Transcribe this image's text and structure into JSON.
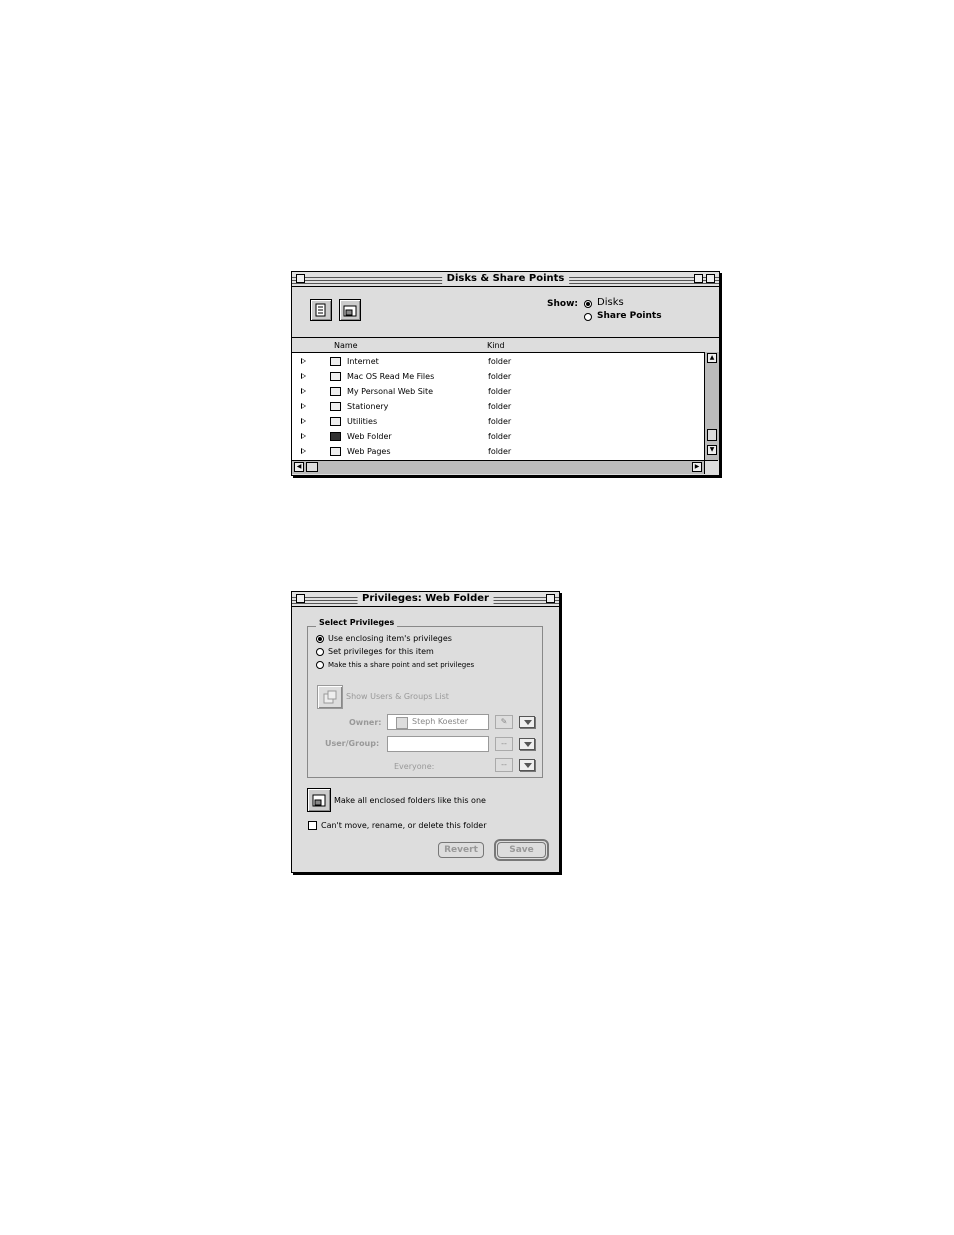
{
  "disks_window": {
    "title": "Disks & Share Points",
    "show_label": "Show:",
    "show_options": [
      "Disks",
      "Share Points"
    ],
    "columns": [
      "Name",
      "Kind"
    ],
    "rows": [
      {
        "name": "Internet",
        "kind": "folder"
      },
      {
        "name": "Mac OS Read Me Files",
        "kind": "folder"
      },
      {
        "name": "My Personal Web Site",
        "kind": "folder"
      },
      {
        "name": "Stationery",
        "kind": "folder"
      },
      {
        "name": "Utilities",
        "kind": "folder"
      },
      {
        "name": "Web Folder",
        "kind": "folder"
      },
      {
        "name": "Web Pages",
        "kind": "folder"
      }
    ]
  },
  "privileges_window": {
    "title": "Privileges: Web Folder",
    "group_title": "Select Privileges",
    "options": [
      "Use enclosing item's privileges",
      "Set privileges for this item",
      "Make this a share point and set privileges"
    ],
    "show_users_label": "Show Users & Groups List",
    "owner_label": "Owner:",
    "owner_value": "Steph Koester",
    "user_group_label": "User/Group:",
    "user_group_value": "",
    "user_group_mini": "--",
    "everyone_label": "Everyone:",
    "everyone_mini": "--",
    "make_all_label": "Make all enclosed folders like this one",
    "cant_move_label": "Can't move, rename, or delete this folder",
    "revert_label": "Revert",
    "save_label": "Save"
  }
}
